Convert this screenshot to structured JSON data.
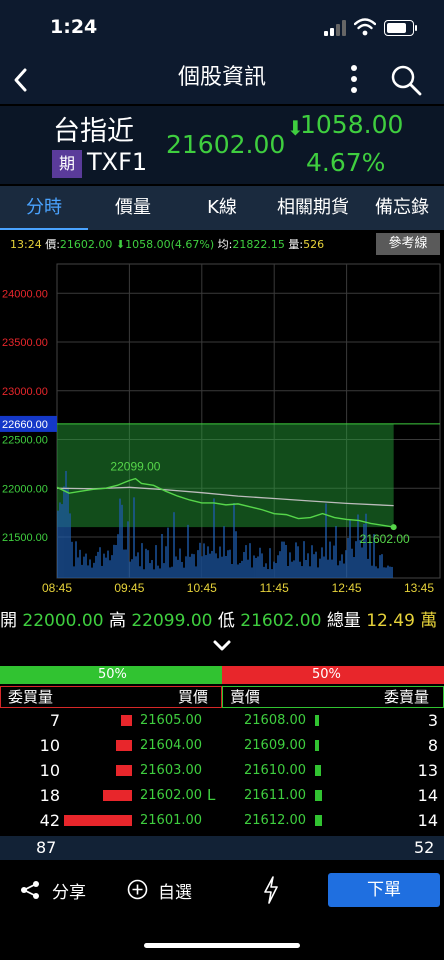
{
  "status_bar": {
    "time": "1:24"
  },
  "nav": {
    "title": "個股資訊"
  },
  "instrument": {
    "name": "台指近",
    "badge": "期",
    "code": "TXF1",
    "price": "21602.00",
    "arrow": "⬇",
    "change": "1058.00",
    "percent": "4.67%"
  },
  "tabs": [
    {
      "label": "分時",
      "active": true
    },
    {
      "label": "價量"
    },
    {
      "label": "K線"
    },
    {
      "label": "相關期貨"
    },
    {
      "label": "備忘錄"
    }
  ],
  "quote_line": {
    "time": "13:24",
    "price_label": "價:",
    "price": "21602.00",
    "change_arrow": "⬇",
    "change": "1058.00(4.67%)",
    "avg_label": "均:",
    "avg": "21822.15",
    "vol_label": "量:",
    "vol": "526"
  },
  "ref_button": "參考線",
  "chart_data": {
    "type": "line",
    "y_ticks": [
      "24000.00",
      "23500.00",
      "23000.00",
      "22660.00",
      "22500.00",
      "22000.00",
      "21500.00"
    ],
    "y_tick_values": [
      24000,
      23500,
      23000,
      22660,
      22500,
      22000,
      21500
    ],
    "ylim": [
      21080,
      24300
    ],
    "x_ticks": [
      "08:45",
      "09:45",
      "10:45",
      "11:45",
      "12:45",
      "13:45"
    ],
    "reference": 22660,
    "annotations": [
      {
        "text": "22099.00",
        "value": 22099,
        "time": "09:50"
      },
      {
        "text": "21602.00",
        "value": 21602,
        "time": "13:24"
      }
    ],
    "price_series": [
      [
        "08:45",
        22010
      ],
      [
        "08:55",
        21950
      ],
      [
        "09:05",
        21970
      ],
      [
        "09:15",
        21990
      ],
      [
        "09:25",
        22000
      ],
      [
        "09:35",
        22030
      ],
      [
        "09:45",
        22080
      ],
      [
        "09:50",
        22099
      ],
      [
        "09:55",
        22050
      ],
      [
        "10:05",
        22030
      ],
      [
        "10:15",
        21970
      ],
      [
        "10:25",
        21920
      ],
      [
        "10:35",
        21880
      ],
      [
        "10:45",
        21850
      ],
      [
        "10:55",
        21850
      ],
      [
        "11:05",
        21830
      ],
      [
        "11:15",
        21840
      ],
      [
        "11:25",
        21810
      ],
      [
        "11:35",
        21780
      ],
      [
        "11:45",
        21740
      ],
      [
        "11:55",
        21730
      ],
      [
        "12:05",
        21690
      ],
      [
        "12:15",
        21700
      ],
      [
        "12:25",
        21740
      ],
      [
        "12:35",
        21700
      ],
      [
        "12:45",
        21680
      ],
      [
        "12:55",
        21670
      ],
      [
        "13:05",
        21640
      ],
      [
        "13:15",
        21620
      ],
      [
        "13:24",
        21602
      ]
    ],
    "avg_series": [
      [
        "08:45",
        22000
      ],
      [
        "09:15",
        21995
      ],
      [
        "09:45",
        22010
      ],
      [
        "10:15",
        21985
      ],
      [
        "10:45",
        21955
      ],
      [
        "11:15",
        21920
      ],
      [
        "11:45",
        21895
      ],
      [
        "12:15",
        21870
      ],
      [
        "12:45",
        21845
      ],
      [
        "13:24",
        21822
      ]
    ],
    "volume_seed": 7
  },
  "summary": {
    "open_label": "開",
    "open": "22000.00",
    "high_label": "高",
    "high": "22099.00",
    "low_label": "低",
    "low": "21602.00",
    "total_label": "總量",
    "total": "12.49",
    "total_unit": "萬"
  },
  "ratio": {
    "buy": "50%",
    "sell": "50%",
    "buy_fraction": 0.5
  },
  "book_header": {
    "buy_qty": "委買量",
    "buy_price": "買價",
    "sell_price": "賣價",
    "sell_qty": "委賣量"
  },
  "book": [
    {
      "bid_qty": "7",
      "bid": "21605.00",
      "ask": "21608.00",
      "ask_qty": "3",
      "bid_n": 7,
      "ask_n": 3
    },
    {
      "bid_qty": "10",
      "bid": "21604.00",
      "ask": "21609.00",
      "ask_qty": "8",
      "bid_n": 10,
      "ask_n": 8
    },
    {
      "bid_qty": "10",
      "bid": "21603.00",
      "ask": "21610.00",
      "ask_qty": "13",
      "bid_n": 10,
      "ask_n": 13
    },
    {
      "bid_qty": "18",
      "bid": "21602.00",
      "ask": "21611.00",
      "ask_qty": "14",
      "bid_n": 18,
      "ask_n": 14,
      "mark": "L"
    },
    {
      "bid_qty": "42",
      "bid": "21601.00",
      "ask": "21612.00",
      "ask_qty": "14",
      "bid_n": 42,
      "ask_n": 14
    }
  ],
  "totals": {
    "buy": "87",
    "sell": "52"
  },
  "toolbar": {
    "share": "分享",
    "favorite": "自選",
    "order": "下單"
  },
  "colors": {
    "up": "#e8262b",
    "down": "#3fce3f",
    "accent": "#4aa3ff"
  }
}
